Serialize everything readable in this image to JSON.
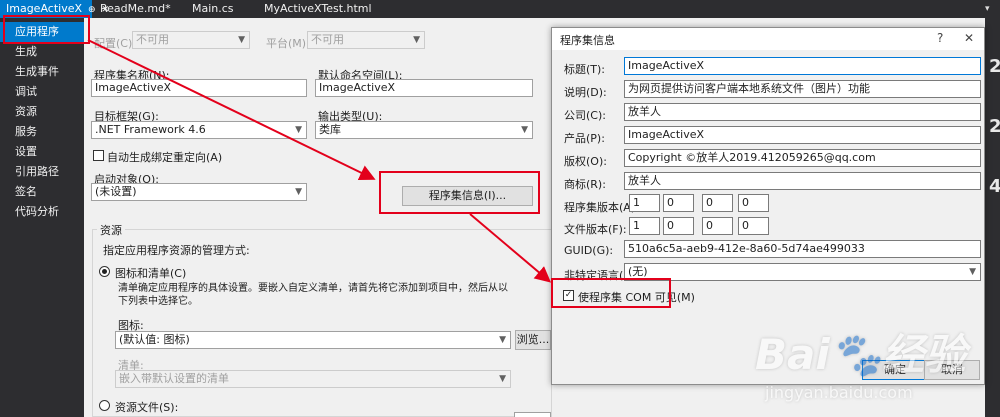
{
  "tabs": [
    {
      "label": "ImageActiveX",
      "active": true
    },
    {
      "label": "ReadMe.md*",
      "active": false
    },
    {
      "label": "Main.cs",
      "active": false
    },
    {
      "label": "MyActiveXTest.html",
      "active": false
    }
  ],
  "tab_controls": {
    "pin": "⊕",
    "close": "✕"
  },
  "sidebar": {
    "items": [
      {
        "label": "应用程序",
        "active": true
      },
      {
        "label": "生成"
      },
      {
        "label": "生成事件"
      },
      {
        "label": "调试"
      },
      {
        "label": "资源"
      },
      {
        "label": "服务"
      },
      {
        "label": "设置"
      },
      {
        "label": "引用路径"
      },
      {
        "label": "签名"
      },
      {
        "label": "代码分析"
      }
    ]
  },
  "config_bar": {
    "config_label": "配置(C):",
    "config_value": "不可用",
    "platform_label": "平台(M):",
    "platform_value": "不可用"
  },
  "app": {
    "assembly_name_label": "程序集名称(N):",
    "assembly_name_value": "ImageActiveX",
    "default_namespace_label": "默认命名空间(L):",
    "default_namespace_value": "ImageActiveX",
    "target_framework_label": "目标框架(G):",
    "target_framework_value": ".NET Framework 4.6",
    "output_type_label": "输出类型(U):",
    "output_type_value": "类库",
    "auto_binding_label": "自动生成绑定重定向(A)",
    "startup_object_label": "启动对象(O):",
    "startup_object_value": "(未设置)",
    "assembly_info_button": "程序集信息(I)..."
  },
  "resources": {
    "group_title": "资源",
    "manage_label": "指定应用程序资源的管理方式:",
    "icon_manifest_label": "图标和清单(C)",
    "icon_manifest_desc": "清单确定应用程序的具体设置。要嵌入自定义清单，请首先将它添加到项目中，然后从以下列表中选择它。",
    "icon_label": "图标:",
    "icon_value": "(默认值: 图标)",
    "browse_button": "浏览...",
    "manifest_label": "清单:",
    "manifest_value": "嵌入带默认设置的清单",
    "resource_file_label": "资源文件(S):"
  },
  "dialog": {
    "title": "程序集信息",
    "help": "?",
    "close": "✕",
    "fields": [
      {
        "label": "标题(T):",
        "value": "ImageActiveX"
      },
      {
        "label": "说明(D):",
        "value": "为网页提供访问客户端本地系统文件（图片）功能"
      },
      {
        "label": "公司(C):",
        "value": "放羊人"
      },
      {
        "label": "产品(P):",
        "value": "ImageActiveX"
      },
      {
        "label": "版权(O):",
        "value": "Copyright ©放羊人2019.412059265@qq.com"
      },
      {
        "label": "商标(R):",
        "value": "放羊人"
      }
    ],
    "assembly_version_label": "程序集版本(A):",
    "assembly_version": [
      "1",
      "0",
      "0",
      "0"
    ],
    "file_version_label": "文件版本(F):",
    "file_version": [
      "1",
      "0",
      "0",
      "0"
    ],
    "guid_label": "GUID(G):",
    "guid_value": "510a6c5a-aeb9-412e-8a60-5d74ae499033",
    "neutral_lang_label": "非特定语言(N):",
    "neutral_lang_value": "(无)",
    "com_visible_label": "使程序集 COM 可见(M)",
    "ok_button": "确定",
    "cancel_button": "取消"
  },
  "right_edge_numbers": [
    "2",
    "2",
    "4"
  ],
  "watermark": {
    "brand": "Bai",
    "brand_suffix": "经验",
    "url": "jingyan.baidu.com"
  },
  "colors": {
    "accent": "#007acc",
    "annotation_red": "#e3001b",
    "dark_chrome": "#2d2d30"
  }
}
